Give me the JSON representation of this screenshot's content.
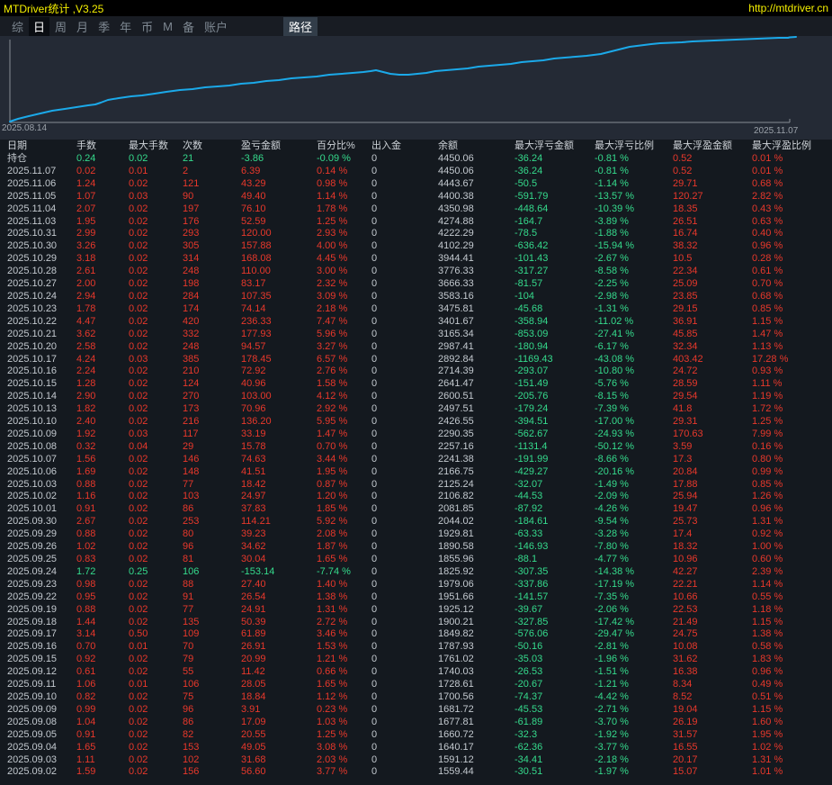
{
  "app": {
    "title": "MTDriver统计 ,V3.25",
    "url": "http://mtdriver.cn"
  },
  "menu": {
    "items": [
      {
        "label": "综",
        "selected": false
      },
      {
        "label": "日",
        "selected": true
      },
      {
        "label": "周",
        "selected": false
      },
      {
        "label": "月",
        "selected": false
      },
      {
        "label": "季",
        "selected": false
      },
      {
        "label": "年",
        "selected": false
      },
      {
        "label": "币",
        "selected": false
      },
      {
        "label": "M",
        "selected": false
      },
      {
        "label": "备",
        "selected": false
      },
      {
        "label": "账户",
        "selected": false
      }
    ],
    "path_button": "路径"
  },
  "chart": {
    "type": "line",
    "description": "equity-curve",
    "start_label": "2025.08.14",
    "end_label": "2025.11.07",
    "line_points": [
      [
        11,
        95
      ],
      [
        20,
        92
      ],
      [
        32,
        89
      ],
      [
        45,
        86
      ],
      [
        58,
        83
      ],
      [
        72,
        81
      ],
      [
        85,
        79
      ],
      [
        98,
        77
      ],
      [
        106,
        76
      ],
      [
        112,
        74
      ],
      [
        120,
        71
      ],
      [
        132,
        69
      ],
      [
        146,
        67
      ],
      [
        158,
        66
      ],
      [
        172,
        64
      ],
      [
        185,
        62
      ],
      [
        200,
        60
      ],
      [
        214,
        59
      ],
      [
        228,
        57
      ],
      [
        242,
        56
      ],
      [
        255,
        55
      ],
      [
        268,
        53
      ],
      [
        282,
        52
      ],
      [
        296,
        50
      ],
      [
        310,
        49
      ],
      [
        324,
        47
      ],
      [
        338,
        46
      ],
      [
        352,
        45
      ],
      [
        366,
        43
      ],
      [
        380,
        42
      ],
      [
        392,
        41
      ],
      [
        404,
        40
      ],
      [
        412,
        39
      ],
      [
        418,
        38
      ],
      [
        426,
        40
      ],
      [
        434,
        42
      ],
      [
        444,
        43
      ],
      [
        454,
        43
      ],
      [
        464,
        42
      ],
      [
        474,
        41
      ],
      [
        484,
        39
      ],
      [
        496,
        38
      ],
      [
        508,
        37
      ],
      [
        520,
        36
      ],
      [
        532,
        34
      ],
      [
        544,
        33
      ],
      [
        556,
        32
      ],
      [
        568,
        31
      ],
      [
        580,
        29
      ],
      [
        592,
        28
      ],
      [
        604,
        27
      ],
      [
        616,
        25
      ],
      [
        628,
        24
      ],
      [
        640,
        23
      ],
      [
        652,
        22
      ],
      [
        660,
        21
      ],
      [
        668,
        20
      ],
      [
        676,
        18
      ],
      [
        684,
        16
      ],
      [
        692,
        14
      ],
      [
        700,
        12
      ],
      [
        708,
        11
      ],
      [
        716,
        10
      ],
      [
        724,
        9
      ],
      [
        734,
        8
      ],
      [
        746,
        7.5
      ],
      [
        758,
        7
      ],
      [
        770,
        6
      ],
      [
        782,
        5.5
      ],
      [
        794,
        5
      ],
      [
        806,
        4.5
      ],
      [
        818,
        4
      ],
      [
        830,
        3.5
      ],
      [
        842,
        3
      ],
      [
        854,
        2.5
      ],
      [
        866,
        2
      ],
      [
        876,
        2
      ],
      [
        878,
        1.5
      ],
      [
        885,
        1
      ]
    ]
  },
  "table": {
    "columns": [
      "日期",
      "手数",
      "最大手数",
      "次数",
      "盈亏金额",
      "百分比%",
      "出入金",
      "余额",
      "最大浮亏金额",
      "最大浮亏比例",
      "最大浮盈金额",
      "最大浮盈比例"
    ],
    "rows": [
      {
        "date": "持仓",
        "trend": "down",
        "values": [
          "0.24",
          "0.02",
          "21",
          "-3.86",
          "-0.09 %",
          "0",
          "4450.06",
          "-36.24",
          "-0.81 %",
          "0.52",
          "0.01 %"
        ]
      },
      {
        "date": "2025.11.07",
        "trend": "up",
        "values": [
          "0.02",
          "0.01",
          "2",
          "6.39",
          "0.14 %",
          "0",
          "4450.06",
          "-36.24",
          "-0.81 %",
          "0.52",
          "0.01 %"
        ]
      },
      {
        "date": "2025.11.06",
        "trend": "up",
        "values": [
          "1.24",
          "0.02",
          "121",
          "43.29",
          "0.98 %",
          "0",
          "4443.67",
          "-50.5",
          "-1.14 %",
          "29.71",
          "0.68 %"
        ]
      },
      {
        "date": "2025.11.05",
        "trend": "up",
        "values": [
          "1.07",
          "0.03",
          "90",
          "49.40",
          "1.14 %",
          "0",
          "4400.38",
          "-591.79",
          "-13.57 %",
          "120.27",
          "2.82 %"
        ]
      },
      {
        "date": "2025.11.04",
        "trend": "up",
        "values": [
          "2.07",
          "0.02",
          "197",
          "76.10",
          "1.78 %",
          "0",
          "4350.98",
          "-448.64",
          "-10.39 %",
          "18.35",
          "0.43 %"
        ]
      },
      {
        "date": "2025.11.03",
        "trend": "up",
        "values": [
          "1.95",
          "0.02",
          "176",
          "52.59",
          "1.25 %",
          "0",
          "4274.88",
          "-164.7",
          "-3.89 %",
          "26.51",
          "0.63 %"
        ]
      },
      {
        "date": "2025.10.31",
        "trend": "up",
        "values": [
          "2.99",
          "0.02",
          "293",
          "120.00",
          "2.93 %",
          "0",
          "4222.29",
          "-78.5",
          "-1.88 %",
          "16.74",
          "0.40 %"
        ]
      },
      {
        "date": "2025.10.30",
        "trend": "up",
        "values": [
          "3.26",
          "0.02",
          "305",
          "157.88",
          "4.00 %",
          "0",
          "4102.29",
          "-636.42",
          "-15.94 %",
          "38.32",
          "0.96 %"
        ]
      },
      {
        "date": "2025.10.29",
        "trend": "up",
        "values": [
          "3.18",
          "0.02",
          "314",
          "168.08",
          "4.45 %",
          "0",
          "3944.41",
          "-101.43",
          "-2.67 %",
          "10.5",
          "0.28 %"
        ]
      },
      {
        "date": "2025.10.28",
        "trend": "up",
        "values": [
          "2.61",
          "0.02",
          "248",
          "110.00",
          "3.00 %",
          "0",
          "3776.33",
          "-317.27",
          "-8.58 %",
          "22.34",
          "0.61 %"
        ]
      },
      {
        "date": "2025.10.27",
        "trend": "up",
        "values": [
          "2.00",
          "0.02",
          "198",
          "83.17",
          "2.32 %",
          "0",
          "3666.33",
          "-81.57",
          "-2.25 %",
          "25.09",
          "0.70 %"
        ]
      },
      {
        "date": "2025.10.24",
        "trend": "up",
        "values": [
          "2.94",
          "0.02",
          "284",
          "107.35",
          "3.09 %",
          "0",
          "3583.16",
          "-104",
          "-2.98 %",
          "23.85",
          "0.68 %"
        ]
      },
      {
        "date": "2025.10.23",
        "trend": "up",
        "values": [
          "1.78",
          "0.02",
          "174",
          "74.14",
          "2.18 %",
          "0",
          "3475.81",
          "-45.68",
          "-1.31 %",
          "29.15",
          "0.85 %"
        ]
      },
      {
        "date": "2025.10.22",
        "trend": "up",
        "values": [
          "4.47",
          "0.02",
          "420",
          "236.33",
          "7.47 %",
          "0",
          "3401.67",
          "-358.94",
          "-11.02 %",
          "36.91",
          "1.15 %"
        ]
      },
      {
        "date": "2025.10.21",
        "trend": "up",
        "values": [
          "3.62",
          "0.02",
          "332",
          "177.93",
          "5.96 %",
          "0",
          "3165.34",
          "-853.09",
          "-27.41 %",
          "45.85",
          "1.47 %"
        ]
      },
      {
        "date": "2025.10.20",
        "trend": "up",
        "values": [
          "2.58",
          "0.02",
          "248",
          "94.57",
          "3.27 %",
          "0",
          "2987.41",
          "-180.94",
          "-6.17 %",
          "32.34",
          "1.13 %"
        ]
      },
      {
        "date": "2025.10.17",
        "trend": "up",
        "values": [
          "4.24",
          "0.03",
          "385",
          "178.45",
          "6.57 %",
          "0",
          "2892.84",
          "-1169.43",
          "-43.08 %",
          "403.42",
          "17.28 %"
        ]
      },
      {
        "date": "2025.10.16",
        "trend": "up",
        "values": [
          "2.24",
          "0.02",
          "210",
          "72.92",
          "2.76 %",
          "0",
          "2714.39",
          "-293.07",
          "-10.80 %",
          "24.72",
          "0.93 %"
        ]
      },
      {
        "date": "2025.10.15",
        "trend": "up",
        "values": [
          "1.28",
          "0.02",
          "124",
          "40.96",
          "1.58 %",
          "0",
          "2641.47",
          "-151.49",
          "-5.76 %",
          "28.59",
          "1.11 %"
        ]
      },
      {
        "date": "2025.10.14",
        "trend": "up",
        "values": [
          "2.90",
          "0.02",
          "270",
          "103.00",
          "4.12 %",
          "0",
          "2600.51",
          "-205.76",
          "-8.15 %",
          "29.54",
          "1.19 %"
        ]
      },
      {
        "date": "2025.10.13",
        "trend": "up",
        "values": [
          "1.82",
          "0.02",
          "173",
          "70.96",
          "2.92 %",
          "0",
          "2497.51",
          "-179.24",
          "-7.39 %",
          "41.8",
          "1.72 %"
        ]
      },
      {
        "date": "2025.10.10",
        "trend": "up",
        "values": [
          "2.40",
          "0.02",
          "216",
          "136.20",
          "5.95 %",
          "0",
          "2426.55",
          "-394.51",
          "-17.00 %",
          "29.31",
          "1.25 %"
        ]
      },
      {
        "date": "2025.10.09",
        "trend": "up",
        "values": [
          "1.92",
          "0.03",
          "117",
          "33.19",
          "1.47 %",
          "0",
          "2290.35",
          "-562.67",
          "-24.93 %",
          "170.63",
          "7.99 %"
        ]
      },
      {
        "date": "2025.10.08",
        "trend": "up",
        "values": [
          "0.32",
          "0.04",
          "29",
          "15.78",
          "0.70 %",
          "0",
          "2257.16",
          "-1131.4",
          "-50.12 %",
          "3.59",
          "0.16 %"
        ]
      },
      {
        "date": "2025.10.07",
        "trend": "up",
        "values": [
          "1.56",
          "0.02",
          "146",
          "74.63",
          "3.44 %",
          "0",
          "2241.38",
          "-191.99",
          "-8.66 %",
          "17.3",
          "0.80 %"
        ]
      },
      {
        "date": "2025.10.06",
        "trend": "up",
        "values": [
          "1.69",
          "0.02",
          "148",
          "41.51",
          "1.95 %",
          "0",
          "2166.75",
          "-429.27",
          "-20.16 %",
          "20.84",
          "0.99 %"
        ]
      },
      {
        "date": "2025.10.03",
        "trend": "up",
        "values": [
          "0.88",
          "0.02",
          "77",
          "18.42",
          "0.87 %",
          "0",
          "2125.24",
          "-32.07",
          "-1.49 %",
          "17.88",
          "0.85 %"
        ]
      },
      {
        "date": "2025.10.02",
        "trend": "up",
        "values": [
          "1.16",
          "0.02",
          "103",
          "24.97",
          "1.20 %",
          "0",
          "2106.82",
          "-44.53",
          "-2.09 %",
          "25.94",
          "1.26 %"
        ]
      },
      {
        "date": "2025.10.01",
        "trend": "up",
        "values": [
          "0.91",
          "0.02",
          "86",
          "37.83",
          "1.85 %",
          "0",
          "2081.85",
          "-87.92",
          "-4.26 %",
          "19.47",
          "0.96 %"
        ]
      },
      {
        "date": "2025.09.30",
        "trend": "up",
        "values": [
          "2.67",
          "0.02",
          "253",
          "114.21",
          "5.92 %",
          "0",
          "2044.02",
          "-184.61",
          "-9.54 %",
          "25.73",
          "1.31 %"
        ]
      },
      {
        "date": "2025.09.29",
        "trend": "up",
        "values": [
          "0.88",
          "0.02",
          "80",
          "39.23",
          "2.08 %",
          "0",
          "1929.81",
          "-63.33",
          "-3.28 %",
          "17.4",
          "0.92 %"
        ]
      },
      {
        "date": "2025.09.26",
        "trend": "up",
        "values": [
          "1.02",
          "0.02",
          "96",
          "34.62",
          "1.87 %",
          "0",
          "1890.58",
          "-146.93",
          "-7.80 %",
          "18.32",
          "1.00 %"
        ]
      },
      {
        "date": "2025.09.25",
        "trend": "up",
        "values": [
          "0.83",
          "0.02",
          "81",
          "30.04",
          "1.65 %",
          "0",
          "1855.96",
          "-88.1",
          "-4.77 %",
          "10.96",
          "0.60 %"
        ]
      },
      {
        "date": "2025.09.24",
        "trend": "down",
        "values": [
          "1.72",
          "0.25",
          "106",
          "-153.14",
          "-7.74 %",
          "0",
          "1825.92",
          "-307.35",
          "-14.38 %",
          "42.27",
          "2.39 %"
        ]
      },
      {
        "date": "2025.09.23",
        "trend": "up",
        "values": [
          "0.98",
          "0.02",
          "88",
          "27.40",
          "1.40 %",
          "0",
          "1979.06",
          "-337.86",
          "-17.19 %",
          "22.21",
          "1.14 %"
        ]
      },
      {
        "date": "2025.09.22",
        "trend": "up",
        "values": [
          "0.95",
          "0.02",
          "91",
          "26.54",
          "1.38 %",
          "0",
          "1951.66",
          "-141.57",
          "-7.35 %",
          "10.66",
          "0.55 %"
        ]
      },
      {
        "date": "2025.09.19",
        "trend": "up",
        "values": [
          "0.88",
          "0.02",
          "77",
          "24.91",
          "1.31 %",
          "0",
          "1925.12",
          "-39.67",
          "-2.06 %",
          "22.53",
          "1.18 %"
        ]
      },
      {
        "date": "2025.09.18",
        "trend": "up",
        "values": [
          "1.44",
          "0.02",
          "135",
          "50.39",
          "2.72 %",
          "0",
          "1900.21",
          "-327.85",
          "-17.42 %",
          "21.49",
          "1.15 %"
        ]
      },
      {
        "date": "2025.09.17",
        "trend": "up",
        "values": [
          "3.14",
          "0.50",
          "109",
          "61.89",
          "3.46 %",
          "0",
          "1849.82",
          "-576.06",
          "-29.47 %",
          "24.75",
          "1.38 %"
        ]
      },
      {
        "date": "2025.09.16",
        "trend": "up",
        "values": [
          "0.70",
          "0.01",
          "70",
          "26.91",
          "1.53 %",
          "0",
          "1787.93",
          "-50.16",
          "-2.81 %",
          "10.08",
          "0.58 %"
        ]
      },
      {
        "date": "2025.09.15",
        "trend": "up",
        "values": [
          "0.92",
          "0.02",
          "79",
          "20.99",
          "1.21 %",
          "0",
          "1761.02",
          "-35.03",
          "-1.96 %",
          "31.62",
          "1.83 %"
        ]
      },
      {
        "date": "2025.09.12",
        "trend": "up",
        "values": [
          "0.61",
          "0.02",
          "55",
          "11.42",
          "0.66 %",
          "0",
          "1740.03",
          "-26.53",
          "-1.51 %",
          "16.38",
          "0.96 %"
        ]
      },
      {
        "date": "2025.09.11",
        "trend": "up",
        "values": [
          "1.06",
          "0.01",
          "106",
          "28.05",
          "1.65 %",
          "0",
          "1728.61",
          "-20.67",
          "-1.21 %",
          "8.34",
          "0.49 %"
        ]
      },
      {
        "date": "2025.09.10",
        "trend": "up",
        "values": [
          "0.82",
          "0.02",
          "75",
          "18.84",
          "1.12 %",
          "0",
          "1700.56",
          "-74.37",
          "-4.42 %",
          "8.52",
          "0.51 %"
        ]
      },
      {
        "date": "2025.09.09",
        "trend": "up",
        "values": [
          "0.99",
          "0.02",
          "96",
          "3.91",
          "0.23 %",
          "0",
          "1681.72",
          "-45.53",
          "-2.71 %",
          "19.04",
          "1.15 %"
        ]
      },
      {
        "date": "2025.09.08",
        "trend": "up",
        "values": [
          "1.04",
          "0.02",
          "86",
          "17.09",
          "1.03 %",
          "0",
          "1677.81",
          "-61.89",
          "-3.70 %",
          "26.19",
          "1.60 %"
        ]
      },
      {
        "date": "2025.09.05",
        "trend": "up",
        "values": [
          "0.91",
          "0.02",
          "82",
          "20.55",
          "1.25 %",
          "0",
          "1660.72",
          "-32.3",
          "-1.92 %",
          "31.57",
          "1.95 %"
        ]
      },
      {
        "date": "2025.09.04",
        "trend": "up",
        "values": [
          "1.65",
          "0.02",
          "153",
          "49.05",
          "3.08 %",
          "0",
          "1640.17",
          "-62.36",
          "-3.77 %",
          "16.55",
          "1.02 %"
        ]
      },
      {
        "date": "2025.09.03",
        "trend": "up",
        "values": [
          "1.11",
          "0.02",
          "102",
          "31.68",
          "2.03 %",
          "0",
          "1591.12",
          "-34.41",
          "-2.18 %",
          "20.17",
          "1.31 %"
        ]
      },
      {
        "date": "2025.09.02",
        "trend": "up",
        "values": [
          "1.59",
          "0.02",
          "156",
          "56.60",
          "3.77 %",
          "0",
          "1559.44",
          "-30.51",
          "-1.97 %",
          "15.07",
          "1.01 %"
        ]
      }
    ]
  },
  "colors": {
    "red": "#e8382b",
    "green": "#35da8c",
    "plain": "#c3c9cf",
    "line": "#1ba9e9",
    "axis": "#878d95",
    "yellow": "#f5f000"
  }
}
